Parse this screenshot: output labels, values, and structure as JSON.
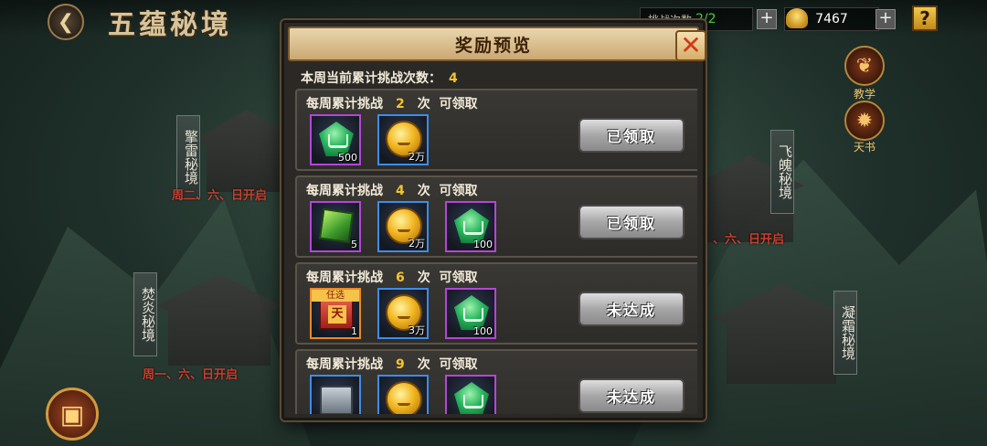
{
  "header": {
    "back_icon": "back-arrow-icon",
    "title": "五蕴秘境",
    "times_label": "挑战次数",
    "times_value": "2/2",
    "gold_value": "7467",
    "plus": "+",
    "help": "?"
  },
  "side_buttons": [
    {
      "name": "教学",
      "icon": "tutorial-icon"
    },
    {
      "name": "天书",
      "icon": "heavenly-book-icon"
    }
  ],
  "map": {
    "realms": [
      {
        "name": "擎雷秘境",
        "days": "周二、六、日开启"
      },
      {
        "name": "飞魄秘境",
        "days": "、六、日开启"
      },
      {
        "name": "焚炎秘境",
        "days": "周一、六、日开启"
      },
      {
        "name": "凝霜秘境",
        "days": ""
      }
    ]
  },
  "modal": {
    "title": "奖励预览",
    "close_icon": "close-x-icon",
    "summary_label": "本周当前累计挑战次数：",
    "summary_value": "4",
    "row_prefix": "每周累计挑战",
    "row_suffix": "次",
    "row_action": "可领取",
    "tiers": [
      {
        "count": "2",
        "button": "已领取",
        "items": [
          {
            "icon": "green-gem-book-icon",
            "rarity": "purple",
            "qty": "500"
          },
          {
            "icon": "gold-coin-icon",
            "rarity": "blue",
            "qty": "2万"
          }
        ]
      },
      {
        "count": "4",
        "button": "已领取",
        "items": [
          {
            "icon": "jade-cube-icon",
            "rarity": "purple",
            "qty": "5"
          },
          {
            "icon": "gold-coin-icon",
            "rarity": "blue",
            "qty": "2万"
          },
          {
            "icon": "green-gem-book-icon",
            "rarity": "purple",
            "qty": "100"
          }
        ]
      },
      {
        "count": "6",
        "button": "未达成",
        "items": [
          {
            "icon": "tian-choice-box-icon",
            "rarity": "orange",
            "qty": "1",
            "tag": "任选",
            "glyph": "天"
          },
          {
            "icon": "gold-coin-icon",
            "rarity": "blue",
            "qty": "3万"
          },
          {
            "icon": "green-gem-book-icon",
            "rarity": "purple",
            "qty": "100"
          }
        ]
      },
      {
        "count": "9",
        "button": "未达成",
        "items": [
          {
            "icon": "silver-chest-icon",
            "rarity": "blue",
            "qty": ""
          },
          {
            "icon": "gold-coin-icon",
            "rarity": "blue",
            "qty": ""
          },
          {
            "icon": "green-gem-book-icon",
            "rarity": "purple",
            "qty": ""
          }
        ]
      }
    ]
  },
  "colors": {
    "accent_gold": "#f4c430",
    "header_parchment": "#e9d6ad",
    "rarity_purple": "#b446d8",
    "rarity_blue": "#3f8ce8",
    "rarity_orange": "#e88a2a",
    "open_days_red": "#c8402f"
  }
}
